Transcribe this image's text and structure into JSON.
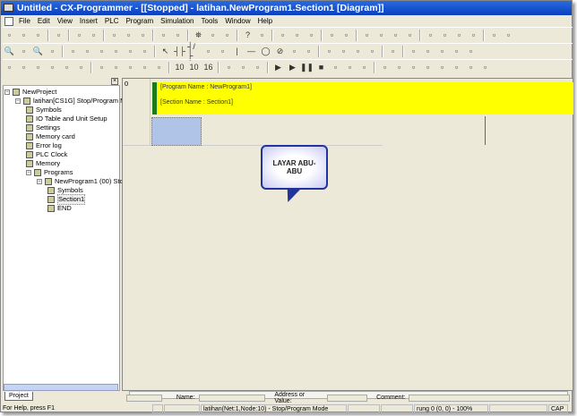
{
  "window": {
    "title": "Untitled - CX-Programmer - [[Stopped] - latihan.NewProgram1.Section1 [Diagram]]"
  },
  "menu": [
    "File",
    "Edit",
    "View",
    "Insert",
    "PLC",
    "Program",
    "Simulation",
    "Tools",
    "Window",
    "Help"
  ],
  "toolbars": [
    [
      "new-icon",
      "open-icon",
      "save-icon",
      "|",
      "print-preview-icon",
      "|",
      "print-icon",
      "preview-icon",
      "|",
      "cut-icon",
      "copy-icon",
      "paste-icon",
      "|",
      "undo-icon",
      "redo-icon",
      "|",
      "find-icon",
      "replace-icon",
      "replace-all-icon",
      "|",
      "help-icon",
      "context-help-icon",
      "|",
      "warning-icon",
      "online-icon",
      "watch-icon",
      "|",
      "plc-icon",
      "monitor-icon",
      "|",
      "transfer-icon",
      "compare-icon",
      "upload-icon",
      "download-icon",
      "|",
      "ladder-icon",
      "mnemonic-icon",
      "st-icon",
      "sfc-icon",
      "|",
      "io-icon",
      "plc-settings-icon"
    ],
    [
      "zoom-in-icon",
      "zoom-fit-icon",
      "zoom-icon",
      "zoom-out-icon",
      "|",
      "grid-icon",
      "symbols-icon",
      "list-icon",
      "rung-icon",
      "section-icon",
      "tree-icon",
      "|",
      "select-icon",
      "contact-no-icon",
      "contact-nc-icon",
      "or-no-icon",
      "or-nc-icon",
      "vertical-icon",
      "horizontal-icon",
      "coil-icon",
      "coil-nc-icon",
      "instruction-icon",
      "bit-icon",
      "|",
      "online-edit-icon",
      "diff-icon",
      "cancel-edit-icon",
      "delete-icon",
      "|",
      "transfer-block-icon",
      "|",
      "sim-icon",
      "sim2-icon",
      "sim3-icon",
      "sim4-icon",
      "sim5-icon"
    ],
    [
      "window-icon",
      "project-icon",
      "output-icon",
      "watch-window-icon",
      "address-icon",
      "io-comment-icon",
      "|",
      "find-ref-icon",
      "cross-ref-icon",
      "memo-icon",
      "address-ref-icon",
      "table-icon",
      "|",
      "hex-10-icon",
      "dec-10-icon",
      "hex-16-icon",
      "|",
      "up-icon",
      "down-icon",
      "step-icon",
      "|",
      "run-icon",
      "play-icon",
      "pause-icon",
      "stop-icon",
      "step-in-icon",
      "step-over-icon",
      "step-out-icon",
      "|",
      "task-icon",
      "task2-icon",
      "task3-icon",
      "task4-icon",
      "task5-icon",
      "task6-icon",
      "task7-icon",
      "task8-icon"
    ]
  ],
  "project_panel": {
    "tab": "Project",
    "tree": [
      {
        "label": "NewProject",
        "level": 0,
        "expand": "-"
      },
      {
        "label": "latihan[CS1G] Stop/Program M",
        "level": 1,
        "expand": "-"
      },
      {
        "label": "Symbols",
        "level": 2
      },
      {
        "label": "IO Table and Unit Setup",
        "level": 2
      },
      {
        "label": "Settings",
        "level": 2
      },
      {
        "label": "Memory card",
        "level": 2
      },
      {
        "label": "Error log",
        "level": 2
      },
      {
        "label": "PLC Clock",
        "level": 2
      },
      {
        "label": "Memory",
        "level": 2
      },
      {
        "label": "Programs",
        "level": 2,
        "expand": "-"
      },
      {
        "label": "NewProgram1 (00) Sto",
        "level": 3,
        "expand": "-"
      },
      {
        "label": "Symbols",
        "level": 4
      },
      {
        "label": "Section1",
        "level": 4,
        "selected": true
      },
      {
        "label": "END",
        "level": 4
      }
    ]
  },
  "diagram": {
    "rung_number": "0",
    "program_name": "[Program Name : NewProgram1]",
    "section_name": "[Section Name : Section1]",
    "comment_color": "#ffff00",
    "callout": "LAYAR ABU-ABU"
  },
  "fields": {
    "name_label": "Name:",
    "address_label": "Address or Value:",
    "comment_label": "Comment:"
  },
  "status": {
    "help": "For Help, press F1",
    "connection": "latihan(Net:1,Node:10) - Stop/Program Mode",
    "position": "rung 0 (0, 0)  - 100%",
    "caps": "CAP"
  }
}
